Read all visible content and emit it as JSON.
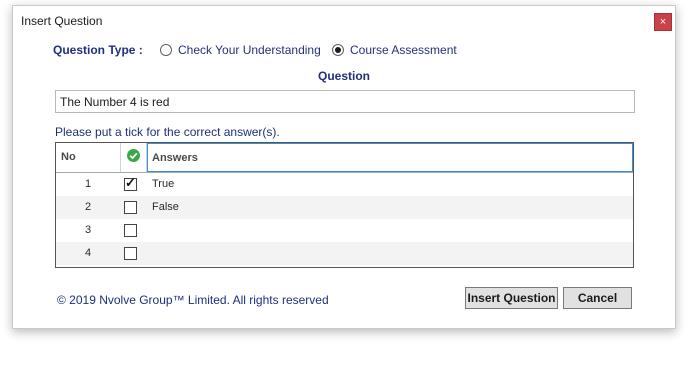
{
  "window": {
    "title": "Insert Question",
    "close_glyph": "×"
  },
  "question_type": {
    "label": "Question Type :",
    "options": [
      {
        "label": "Check Your Understanding",
        "selected": false
      },
      {
        "label": "Course Assessment",
        "selected": true
      }
    ]
  },
  "question": {
    "label": "Question",
    "value": "The Number 4 is red"
  },
  "hint": "Please put a tick for the correct answer(s).",
  "answers_table": {
    "headers": {
      "no": "No",
      "check_icon": "check-circle-icon",
      "answers": "Answers"
    },
    "rows": [
      {
        "no": "1",
        "checked": true,
        "answer": "True"
      },
      {
        "no": "2",
        "checked": false,
        "answer": "False"
      },
      {
        "no": "3",
        "checked": false,
        "answer": ""
      },
      {
        "no": "4",
        "checked": false,
        "answer": ""
      }
    ]
  },
  "footer": {
    "copyright": "© 2019 Nvolve Group™  Limited. All rights reserved"
  },
  "buttons": {
    "insert": "Insert Question",
    "cancel": "Cancel"
  },
  "colors": {
    "accent": "#1f2f7c",
    "close_bg": "#c9424a",
    "check_green": "#3aa84a",
    "header_focus": "#3c8fd6"
  }
}
